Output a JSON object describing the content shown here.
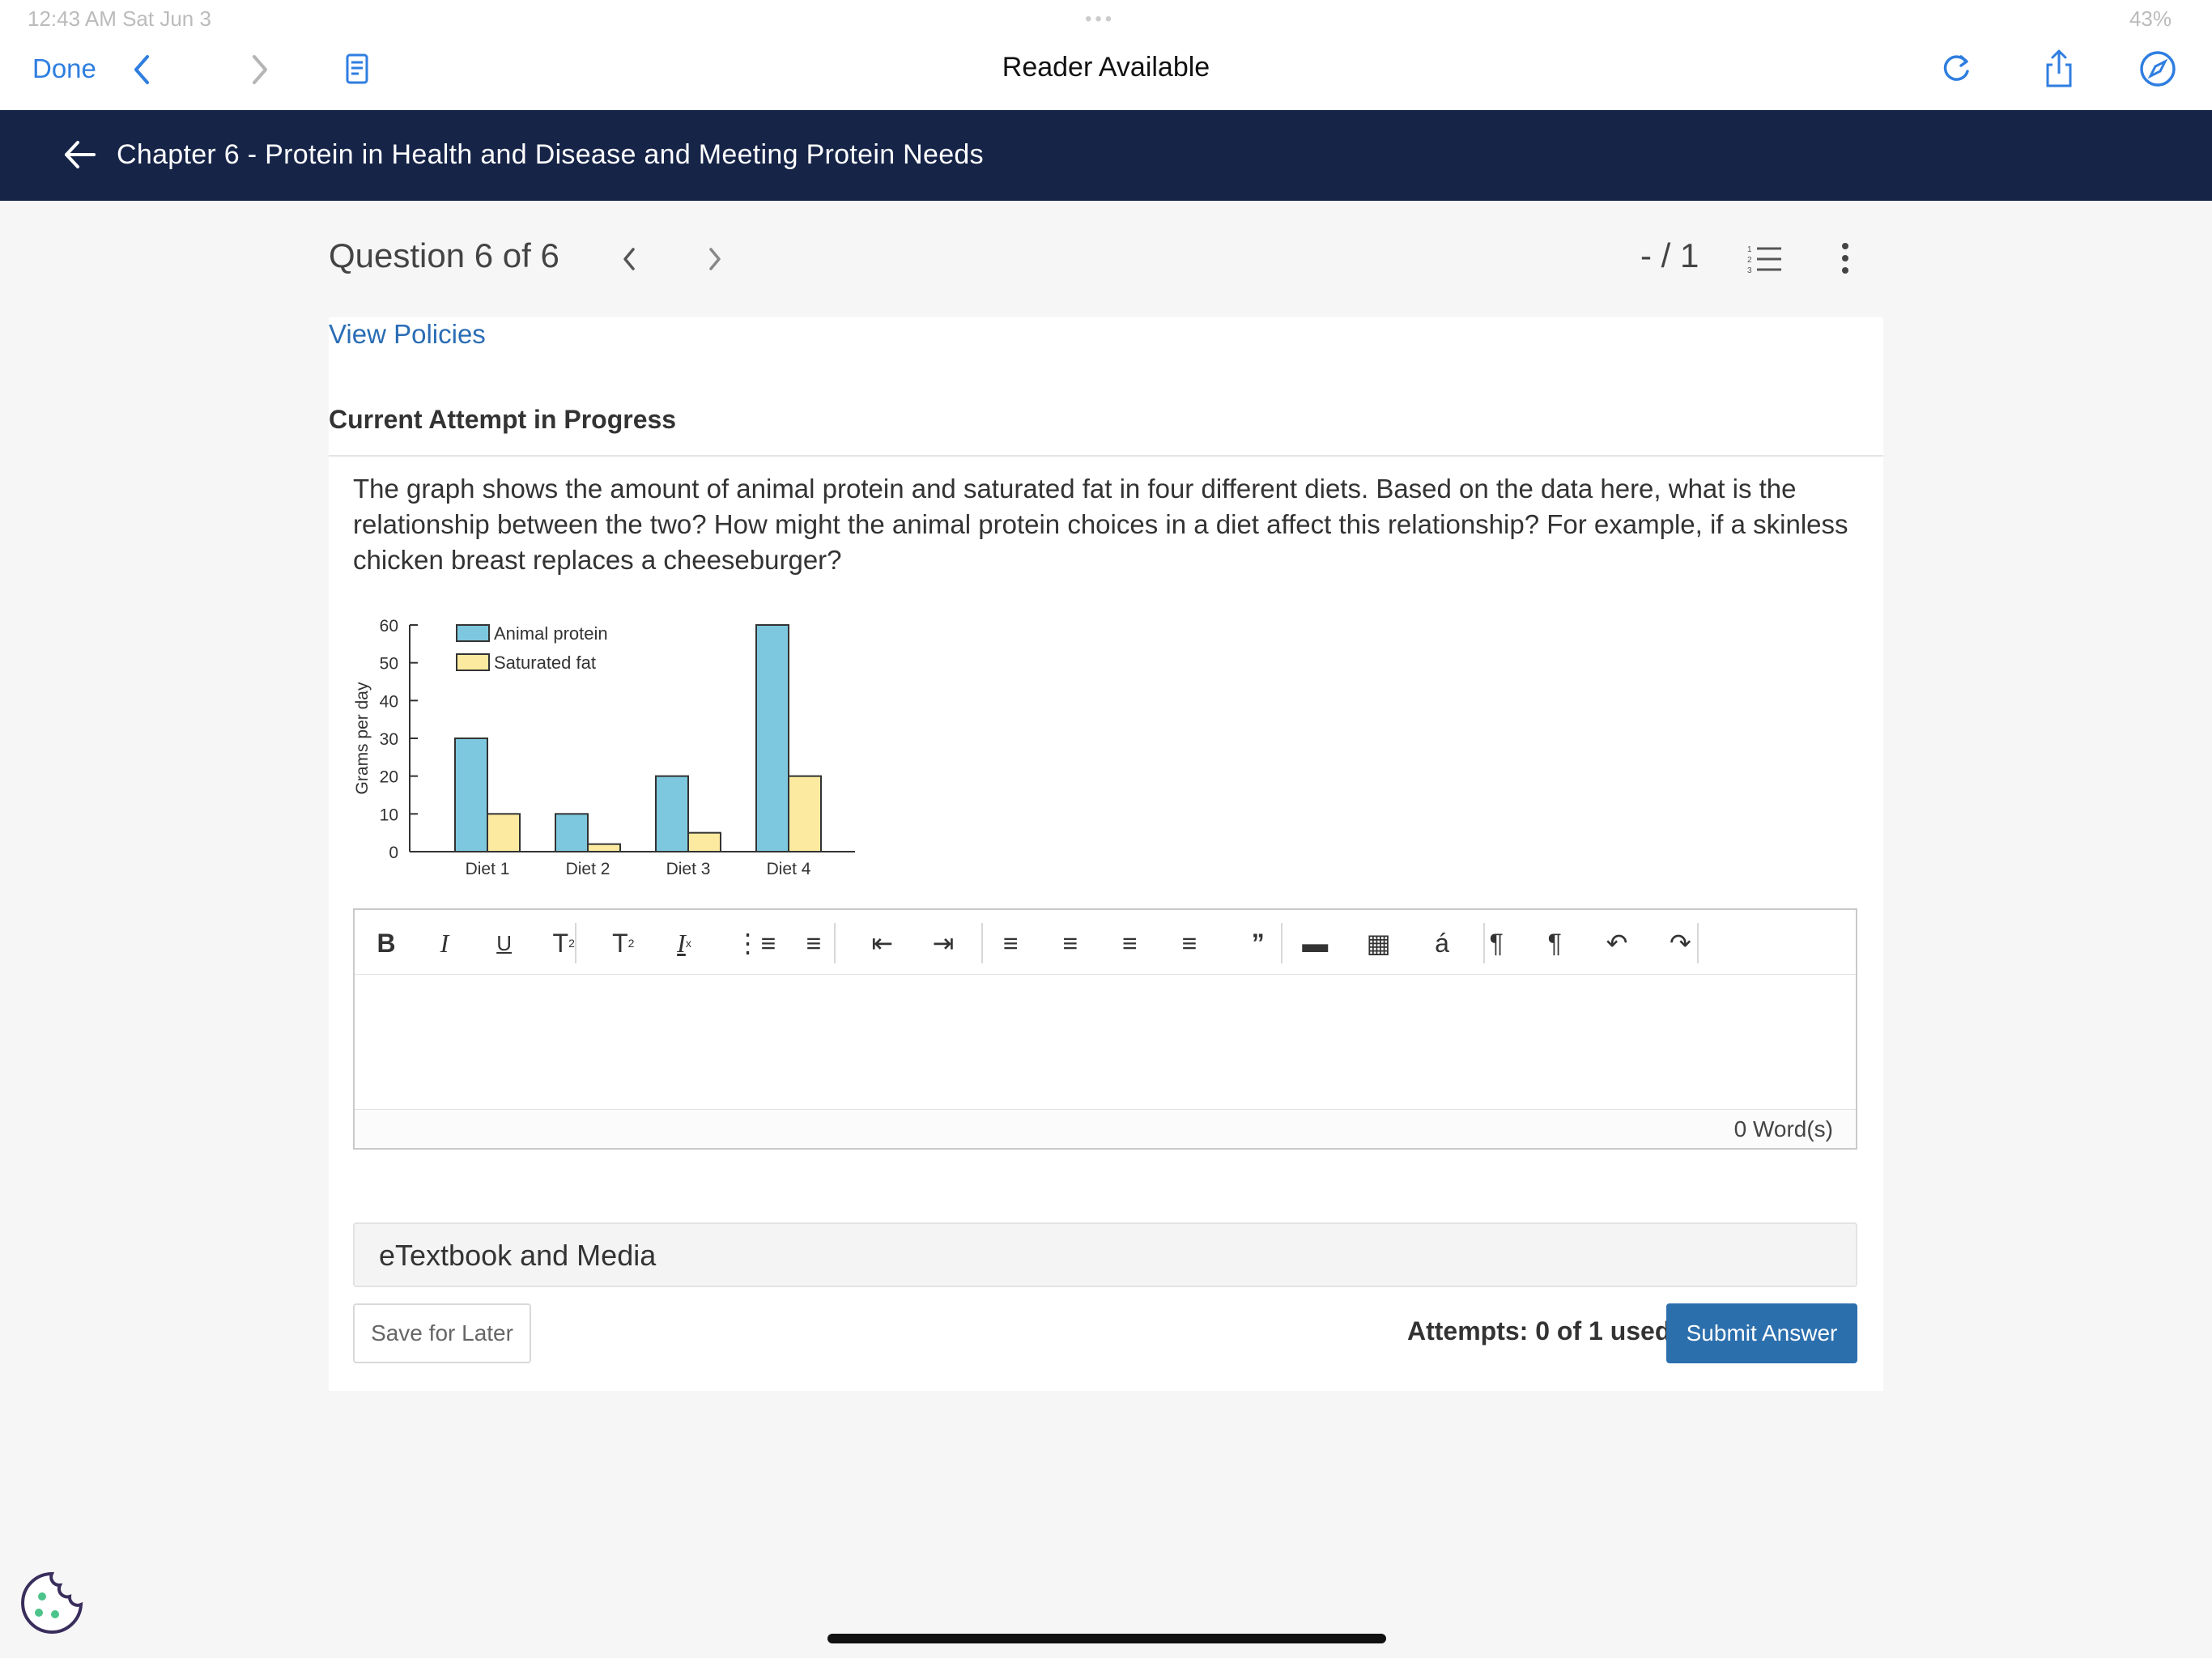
{
  "status": {
    "time": "12:43 AM  Sat Jun 3",
    "battery": "43%"
  },
  "safari": {
    "done_label": "Done",
    "title": "Reader Available"
  },
  "course": {
    "chapter_title": "Chapter 6 - Protein in Health and Disease and Meeting Protein Needs"
  },
  "question": {
    "header": "Question 6 of 6",
    "score": "- / 1",
    "view_policies": "View Policies",
    "attempt_label": "Current Attempt in Progress",
    "text": "The graph shows the amount of animal protein and saturated fat in four different diets. Based on the data here, what is the relationship between the two? How might the animal protein choices in a diet affect this relationship? For example, if a skinless chicken breast replaces a cheeseburger?"
  },
  "chart_data": {
    "type": "bar",
    "categories": [
      "Diet 1",
      "Diet 2",
      "Diet 3",
      "Diet 4"
    ],
    "series": [
      {
        "name": "Animal protein",
        "values": [
          30,
          10,
          20,
          60
        ],
        "color": "#7ec8df"
      },
      {
        "name": "Saturated fat",
        "values": [
          10,
          2,
          5,
          20
        ],
        "color": "#fbeaa0"
      }
    ],
    "yticks": [
      "0",
      "10",
      "20",
      "30",
      "40",
      "50",
      "60"
    ],
    "ylabel": "Grams per day",
    "ylim": [
      0,
      60
    ],
    "legend": "top-left"
  },
  "editor": {
    "tools": [
      "bold",
      "italic",
      "underline",
      "subscript",
      "superscript",
      "clear-format",
      "bullet-list",
      "numbered-list",
      "outdent",
      "indent",
      "align-left",
      "align-center",
      "align-right",
      "align-justify",
      "blockquote",
      "horizontal-rule",
      "table",
      "special-char",
      "ltr",
      "rtl",
      "undo",
      "redo"
    ],
    "word_count": "0 Word(s)"
  },
  "media": {
    "label": "eTextbook and Media"
  },
  "footer": {
    "save_label": "Save for Later",
    "attempts": "Attempts: 0 of 1 used",
    "submit_label": "Submit Answer"
  }
}
